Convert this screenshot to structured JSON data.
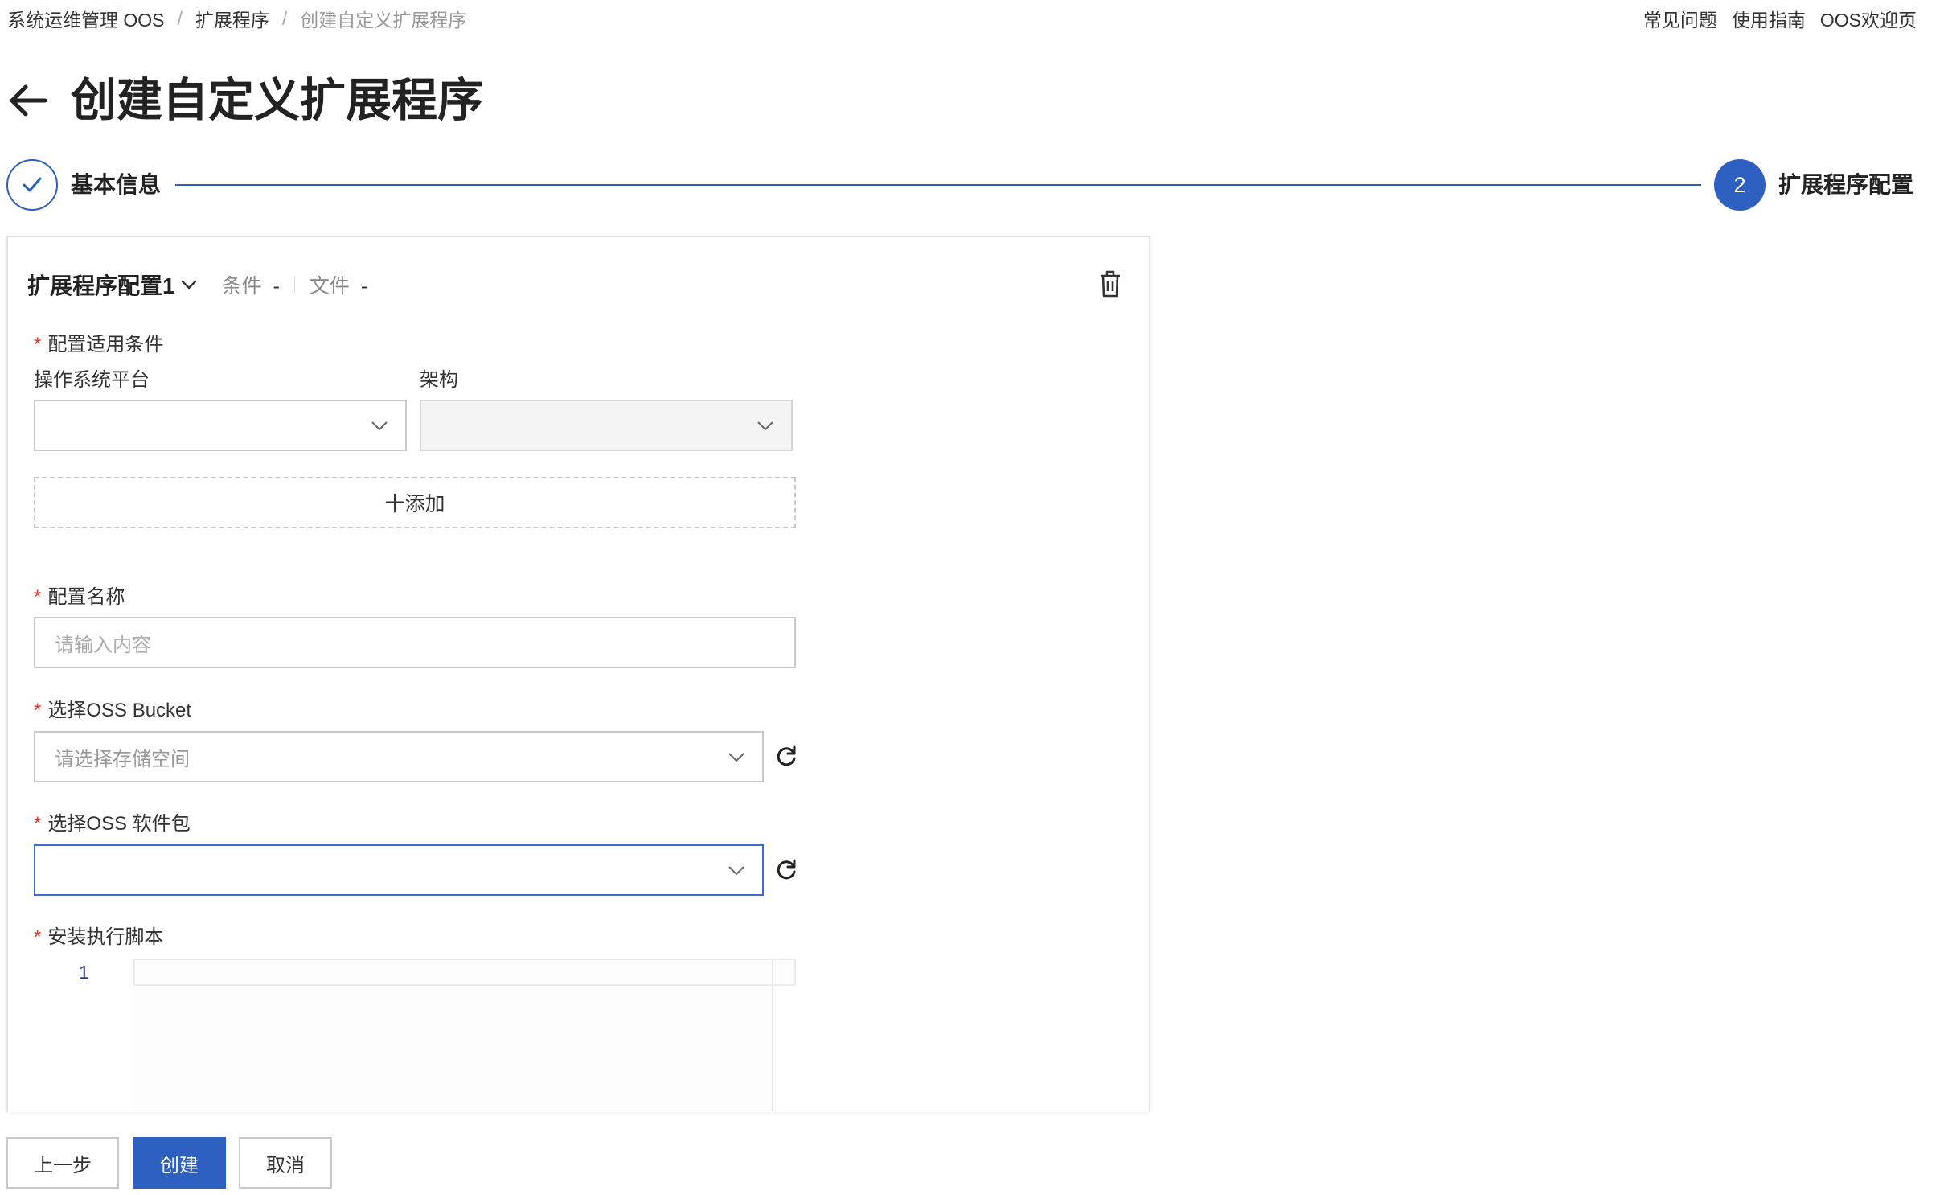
{
  "breadcrumb": [
    "系统运维管理 OOS",
    "扩展程序",
    "创建自定义扩展程序"
  ],
  "header_links": [
    "常见问题",
    "使用指南",
    "OOS欢迎页"
  ],
  "page_title": "创建自定义扩展程序",
  "steps": [
    {
      "label": "基本信息",
      "status": "done"
    },
    {
      "number": "2",
      "label": "扩展程序配置",
      "status": "current"
    }
  ],
  "config": {
    "title": "扩展程序配置1",
    "condition_label": "条件",
    "condition_value": "-",
    "file_label": "文件",
    "file_value": "-"
  },
  "form": {
    "applicable_conditions": "配置适用条件",
    "os_platform_label": "操作系统平台",
    "os_platform_value": "",
    "arch_label": "架构",
    "arch_value": "",
    "add_label": "十添加",
    "name_label": "配置名称",
    "name_placeholder": "请输入内容",
    "bucket_label": "选择OSS Bucket",
    "bucket_placeholder": "请选择存储空间",
    "package_label": "选择OSS 软件包",
    "package_value": "",
    "script_label": "安装执行脚本",
    "script_line_number": "1"
  },
  "buttons": {
    "prev": "上一步",
    "create": "创建",
    "cancel": "取消"
  },
  "colors": {
    "primary": "#2d60c0",
    "required": "#d9382c",
    "border": "#c9c9c9"
  },
  "icons": [
    "back-arrow-icon",
    "check-icon",
    "chevron-down-icon",
    "trash-icon",
    "refresh-icon"
  ]
}
